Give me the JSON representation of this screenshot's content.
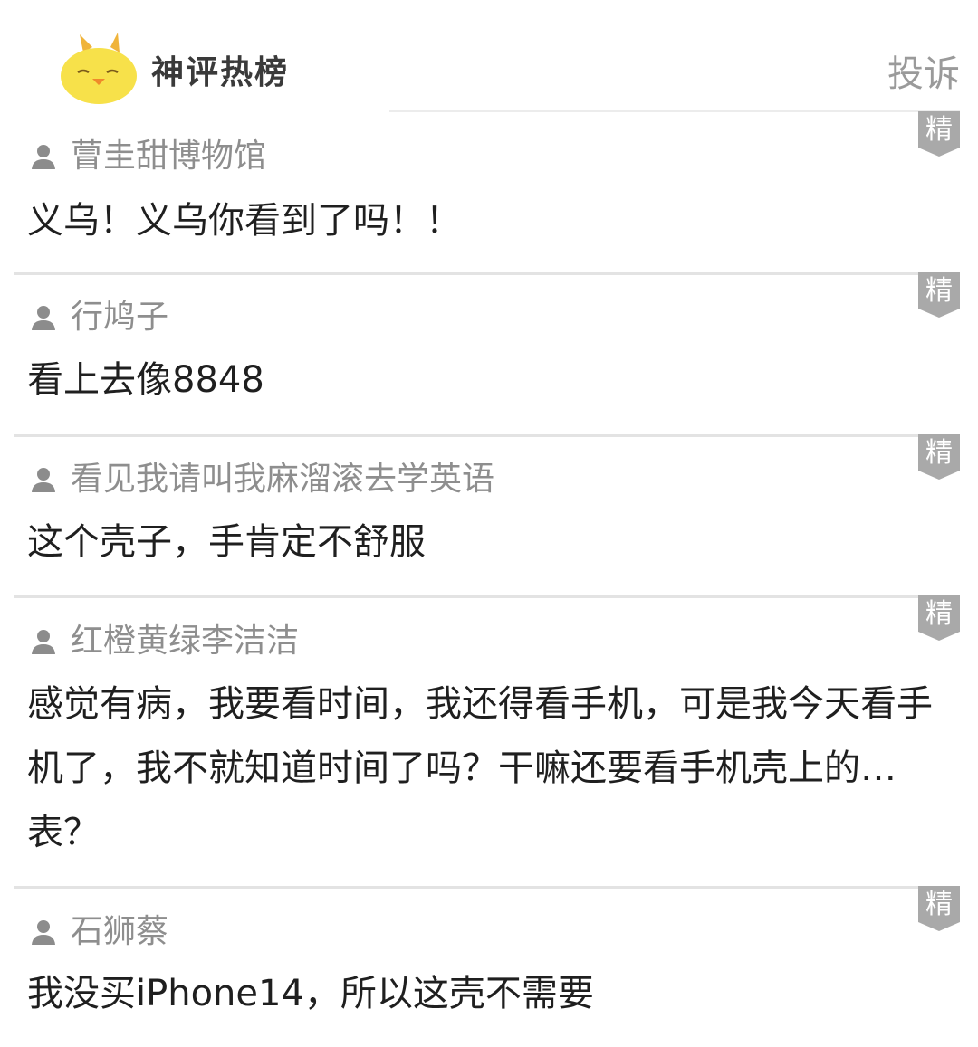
{
  "header": {
    "brand_title": "神评热榜",
    "report_label": "投诉"
  },
  "badge_label": "精",
  "comments": [
    {
      "user": "萺圭甜博物馆",
      "text": "义乌！义乌你看到了吗！！"
    },
    {
      "user": "行鸠子",
      "text": "看上去像8848"
    },
    {
      "user": "看见我请叫我麻溜滚去学英语",
      "text": "这个壳子，手肯定不舒服"
    },
    {
      "user": "红橙黄绿李洁洁",
      "text": "感觉有病，我要看时间，我还得看手机，可是我今天看手机了，我不就知道时间了吗？干嘛还要看手机壳上的…表？"
    },
    {
      "user": "石狮蔡",
      "text": "我没买iPhone14，所以这壳不需要"
    }
  ],
  "colors": {
    "logo_yellow": "#f7e14a",
    "badge_gray": "#a9a9a9",
    "username_gray": "#8e8e8e",
    "text_dark": "#1f1f1f"
  }
}
